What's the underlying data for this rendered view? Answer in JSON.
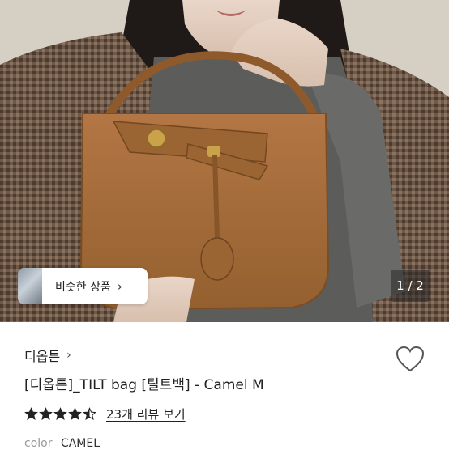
{
  "gallery": {
    "current_page": "1",
    "separator": " / ",
    "total_pages": "2",
    "similar_button_label": "비슷한 상품",
    "similar_chevron": "›"
  },
  "product": {
    "shop_name": "디옵튼",
    "shop_chevron": "›",
    "title": "[디옵튼]_TILT bag [틸트백] - Camel M",
    "rating": 4.5,
    "reviews_link": "23개 리뷰 보기",
    "option_label": "color",
    "option_value": "CAMEL"
  },
  "colors": {
    "bag": "#a56a3a",
    "coat": "#6e5848",
    "sweater": "#5c5c5a",
    "star": "#222222"
  },
  "icons": {
    "like": "heart-outline-icon",
    "star": "star-icon"
  }
}
